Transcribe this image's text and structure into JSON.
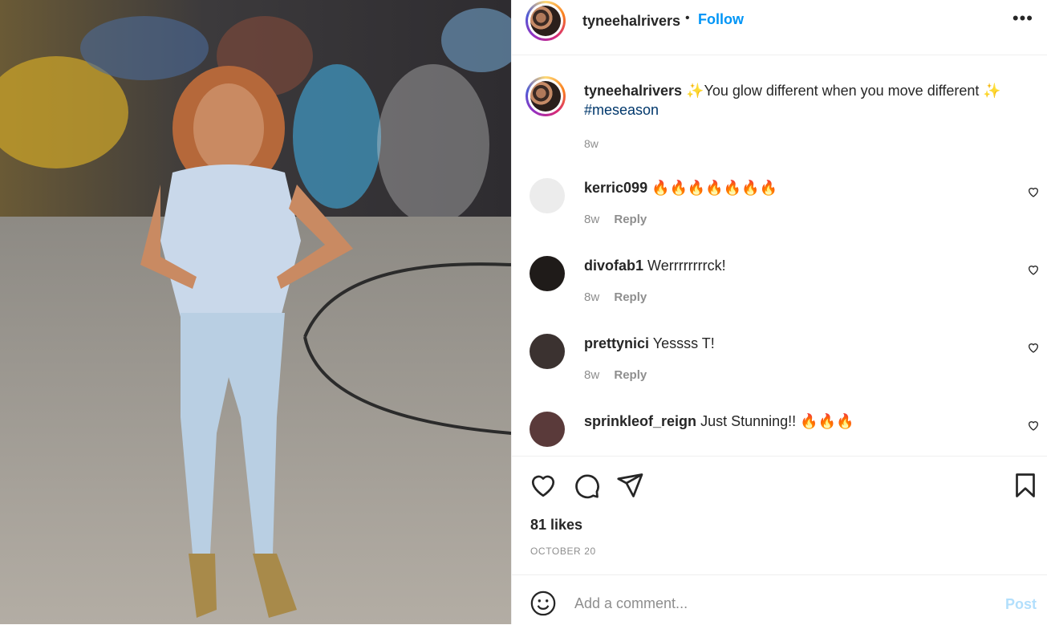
{
  "post": {
    "username": "tyneehalrivers",
    "follow_label": "Follow",
    "separator": "•",
    "more_label": "•••"
  },
  "caption": {
    "username": "tyneehalrivers",
    "text": "✨You glow different when you move different ✨",
    "hashtag": "#meseason",
    "time": "8w"
  },
  "comments": [
    {
      "username": "kerric099",
      "text": "🔥🔥🔥🔥🔥🔥🔥",
      "time": "8w",
      "reply_label": "Reply",
      "avatar_color": "#e9e9e9"
    },
    {
      "username": "divofab1",
      "text": "Werrrrrrrrck!",
      "time": "8w",
      "reply_label": "Reply",
      "avatar_color": "#1f1b19"
    },
    {
      "username": "prettynici",
      "text": "Yessss T!",
      "time": "8w",
      "reply_label": "Reply",
      "avatar_color": "#3b3230"
    },
    {
      "username": "sprinkleof_reign",
      "text": "Just Stunning!! 🔥🔥🔥",
      "time": "",
      "reply_label": "",
      "avatar_color": "#5a3a3a"
    }
  ],
  "actions": {
    "likes": "81 likes",
    "date": "OCTOBER 20"
  },
  "add_comment": {
    "placeholder": "Add a comment...",
    "post_label": "Post"
  },
  "colors": {
    "accent": "#0095f6",
    "post_disabled": "#b2dffc",
    "hashtag": "#00376b",
    "muted": "#8e8e8e"
  },
  "icons": [
    "emoji-icon",
    "heart-icon",
    "comment-icon",
    "share-icon",
    "bookmark-icon",
    "more-icon"
  ]
}
